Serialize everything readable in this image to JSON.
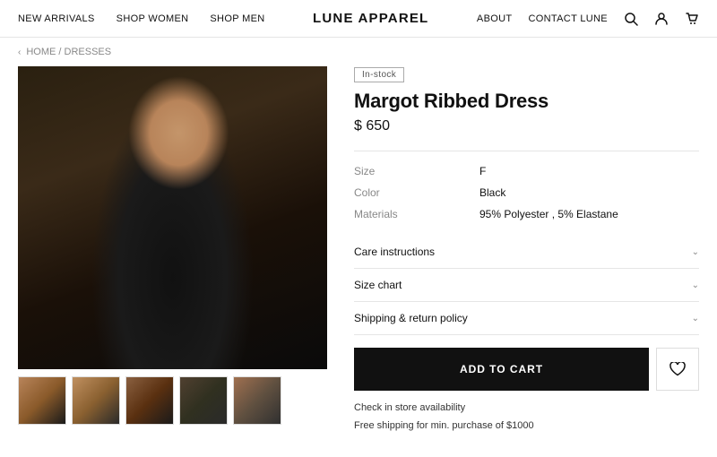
{
  "header": {
    "logo": "LUNE APPAREL",
    "nav_left": [
      {
        "label": "NEW ARRIVALS",
        "href": "#"
      },
      {
        "label": "SHOP WOMEN",
        "href": "#"
      },
      {
        "label": "SHOP MEN",
        "href": "#"
      }
    ],
    "nav_right": [
      {
        "label": "ABOUT",
        "href": "#"
      },
      {
        "label": "CONTACT LUNE",
        "href": "#"
      }
    ]
  },
  "breadcrumb": {
    "back_label": "HOME / DRESSES"
  },
  "product": {
    "badge": "In-stock",
    "name": "Margot Ribbed Dress",
    "price": "$ 650",
    "details": [
      {
        "label": "Size",
        "value": "F"
      },
      {
        "label": "Color",
        "value": "Black"
      },
      {
        "label": "Materials",
        "value": "95% Polyester , 5% Elastane"
      }
    ],
    "accordions": [
      {
        "label": "Care instructions"
      },
      {
        "label": "Size chart"
      },
      {
        "label": "Shipping & return policy"
      }
    ],
    "add_to_cart_label": "ADD TO CART",
    "check_store": "Check in store availability",
    "free_shipping": "Free shipping for min. purchase of $1000"
  },
  "thumbnails": [
    {
      "id": "thumb-1",
      "class": "thumb-1"
    },
    {
      "id": "thumb-2",
      "class": "thumb-2"
    },
    {
      "id": "thumb-3",
      "class": "thumb-3"
    },
    {
      "id": "thumb-4",
      "class": "thumb-4"
    },
    {
      "id": "thumb-5",
      "class": "thumb-5"
    }
  ]
}
